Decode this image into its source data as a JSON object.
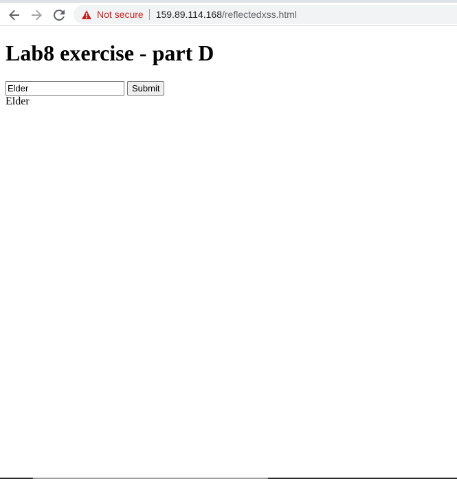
{
  "browser": {
    "back_icon": "arrow-left-icon",
    "forward_icon": "arrow-right-icon",
    "reload_icon": "reload-icon",
    "security_icon": "warning-triangle-icon",
    "security_label": "Not secure",
    "security_color": "#c5221f",
    "url_host": "159.89.114.168",
    "url_path": "/reflectedxss.html"
  },
  "page": {
    "heading": "Lab8 exercise - part D",
    "input_value": "Elder",
    "submit_label": "Submit",
    "echo_text": "Elder"
  }
}
